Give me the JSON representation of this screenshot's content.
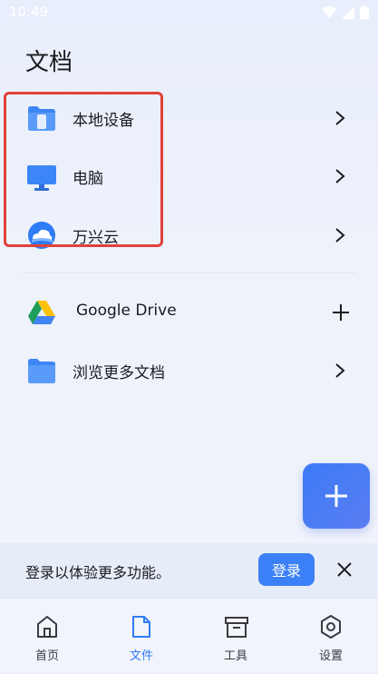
{
  "status_bar": {
    "time": "10:49"
  },
  "page_title": "文档",
  "locations": [
    {
      "label": "本地设备",
      "icon": "phone-folder-icon"
    },
    {
      "label": "电脑",
      "icon": "monitor-icon"
    },
    {
      "label": "万兴云",
      "icon": "cloud-icon"
    }
  ],
  "sources": [
    {
      "label": "Google Drive",
      "icon": "google-drive-icon",
      "action": "plus-icon"
    },
    {
      "label": "浏览更多文档",
      "icon": "folder-icon",
      "action": "chevron-right-icon"
    }
  ],
  "login_bar": {
    "message": "登录以体验更多功能。",
    "button_label": "登录"
  },
  "bottom_nav": [
    {
      "label": "首页",
      "icon": "home-icon",
      "active": false
    },
    {
      "label": "文件",
      "icon": "file-icon",
      "active": true
    },
    {
      "label": "工具",
      "icon": "archive-box-icon",
      "active": false
    },
    {
      "label": "设置",
      "icon": "settings-hex-icon",
      "active": false
    }
  ],
  "colors": {
    "accent": "#2f7bf5",
    "highlight": "#e0413b",
    "background": "#eef2fb"
  }
}
